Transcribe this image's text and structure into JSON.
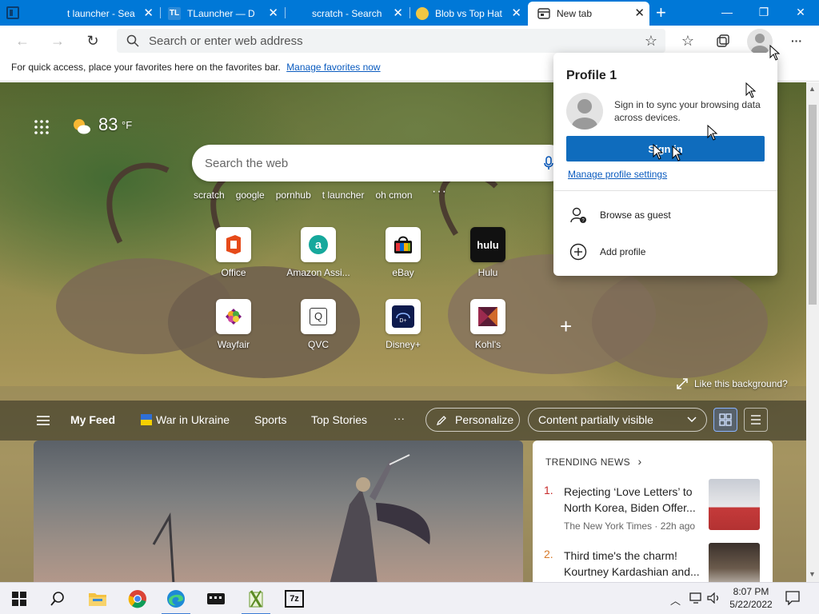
{
  "tabs": [
    {
      "title": "t launcher - Sea",
      "close": "✕"
    },
    {
      "title": "TLauncher — Do",
      "close": "✕"
    },
    {
      "title": "scratch - Search",
      "close": "✕"
    },
    {
      "title": "Blob vs Top Hat",
      "close": "✕"
    },
    {
      "title": "New tab",
      "close": "✕"
    }
  ],
  "window_controls": {
    "minimize": "—",
    "restore": "❐",
    "close": "✕"
  },
  "toolbar": {
    "address_placeholder": "Search or enter web address",
    "back": "←",
    "forward": "→",
    "refresh": "↻",
    "more": "···"
  },
  "favorites_bar": {
    "message": "For quick access, place your favorites here on the favorites bar.",
    "link": "Manage favorites now"
  },
  "weather": {
    "temp": "83",
    "unit": "°F"
  },
  "web_search": {
    "placeholder": "Search the web"
  },
  "quick_searches": [
    "scratch",
    "google",
    "pornhub",
    "t launcher",
    "oh cmon"
  ],
  "quick_more": "···",
  "top_sites": [
    {
      "label": "Office"
    },
    {
      "label": "Amazon Assi..."
    },
    {
      "label": "eBay"
    },
    {
      "label": "Hulu",
      "tile_text": "hulu"
    },
    {
      "label": "Wayfair"
    },
    {
      "label": "QVC",
      "tile_text": "Q"
    },
    {
      "label": "Disney+"
    },
    {
      "label": "Kohl's"
    }
  ],
  "like_background": "Like this background?",
  "feed_nav": {
    "my_feed": "My Feed",
    "items": [
      "War in Ukraine",
      "Sports",
      "Top Stories"
    ],
    "more": "···",
    "personalize": "Personalize",
    "content_visibility": "Content partially visible"
  },
  "trending": {
    "heading": "TRENDING NEWS",
    "items": [
      {
        "num": "1.",
        "headline": "Rejecting ‘Love Letters’ to North Korea, Biden Offer...",
        "source": "The New York Times · 22h ago"
      },
      {
        "num": "2.",
        "headline": "Third time's the charm! Kourtney Kardashian and...",
        "source": ""
      }
    ]
  },
  "profile_popup": {
    "title": "Profile 1",
    "sync_text": "Sign in to sync your browsing data across devices.",
    "sign_in": "Sign in",
    "manage": "Manage profile settings",
    "browse_guest": "Browse as guest",
    "add_profile": "Add profile"
  },
  "taskbar": {
    "time": "8:07 PM",
    "date": "5/22/2022",
    "app_7z": "7z"
  },
  "colors": {
    "accent": "#0078d7",
    "signin_button": "#0f6cbd",
    "trending_number": "#c72a2a",
    "link": "#0a5bbf"
  }
}
